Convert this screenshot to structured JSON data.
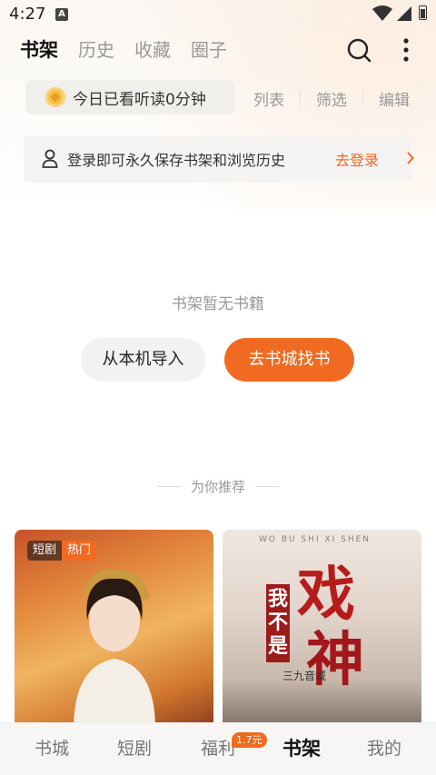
{
  "status_bar": {
    "time": "4:27",
    "notif_icon_letter": "A"
  },
  "top_tabs": [
    {
      "label": "书架",
      "active": true
    },
    {
      "label": "历史",
      "active": false
    },
    {
      "label": "收藏",
      "active": false
    },
    {
      "label": "圈子",
      "active": false
    }
  ],
  "reading": {
    "text": "今日已看听读0分钟"
  },
  "toolbar": {
    "list": "列表",
    "filter": "筛选",
    "edit": "编辑"
  },
  "login_banner": {
    "text": "登录即可永久保存书架和浏览历史",
    "link": "去登录"
  },
  "empty": {
    "message": "书架暂无书籍",
    "import_button": "从本机导入",
    "store_button": "去书城找书"
  },
  "recommend": {
    "title": "为你推荐",
    "cards": [
      {
        "tags": [
          "短剧",
          "热门"
        ]
      },
      {
        "cover_title_1": "戏",
        "cover_title_2": "神",
        "cover_side": "我不是",
        "publisher": "三九音域",
        "top_text": "WO BU SHI XI SHEN"
      }
    ]
  },
  "bottom_nav": [
    {
      "label": "书城",
      "active": false
    },
    {
      "label": "短剧",
      "active": false
    },
    {
      "label": "福利",
      "active": false,
      "badge": "1.7元"
    },
    {
      "label": "书架",
      "active": true
    },
    {
      "label": "我的",
      "active": false
    }
  ],
  "colors": {
    "accent": "#f06a22"
  }
}
